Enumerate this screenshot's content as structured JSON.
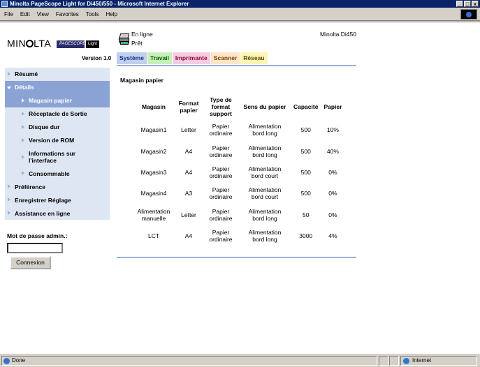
{
  "window": {
    "title": "Minolta PageScope Light for Di450/550 - Microsoft Internet Explorer",
    "min": "_",
    "max": "□",
    "close": "x"
  },
  "menu": [
    "File",
    "Edit",
    "View",
    "Favorites",
    "Tools",
    "Help"
  ],
  "logo": {
    "brand_a": "MIN",
    "brand_b": "LTA",
    "pagescope": "PAGESCOPE",
    "light": "Light",
    "version": "Version 1.0"
  },
  "sidebar": {
    "items": [
      {
        "label": "Résumé"
      },
      {
        "label": "Détails"
      },
      {
        "label": "Magasin papier"
      },
      {
        "label": "Réceptacle de Sortie"
      },
      {
        "label": "Disque dur"
      },
      {
        "label": "Version de ROM"
      },
      {
        "label": "Informations sur l'interface"
      },
      {
        "label": "Consommable"
      },
      {
        "label": "Préférence"
      },
      {
        "label": "Enregistrer Réglage"
      },
      {
        "label": "Assistance en ligne"
      }
    ]
  },
  "login": {
    "label": "Mot de passe admin.:",
    "password": "",
    "button": "Connexion"
  },
  "status": {
    "online": "En ligne",
    "ready": "Prêt",
    "model": "Minolta Di450"
  },
  "tabs": [
    "Système",
    "Travail",
    "Imprimante",
    "Scanner",
    "Réseau"
  ],
  "section": {
    "title": "Magasin papier"
  },
  "table": {
    "headers": [
      "Magasin",
      "Format papier",
      "Type de format support",
      "Sens du papier",
      "Capacité",
      "Papier"
    ],
    "rows": [
      [
        "Magasin1",
        "Letter",
        "Papier ordinaire",
        "Alimentation bord long",
        "500",
        "10%"
      ],
      [
        "Magasin2",
        "A4",
        "Papier ordinaire",
        "Alimentation bord long",
        "500",
        "40%"
      ],
      [
        "Magasin3",
        "A4",
        "Papier ordinaire",
        "Alimentation bord court",
        "500",
        "0%"
      ],
      [
        "Magasin4",
        "A3",
        "Papier ordinaire",
        "Alimentation bord court",
        "500",
        "0%"
      ],
      [
        "Alimentation manuelle",
        "Letter",
        "Papier ordinaire",
        "Alimentation bord long",
        "50",
        "0%"
      ],
      [
        "LCT",
        "A4",
        "Papier ordinaire",
        "Alimentation bord long",
        "3000",
        "4%"
      ]
    ]
  },
  "statusbar": {
    "done": "Done",
    "zone": "Internet"
  }
}
